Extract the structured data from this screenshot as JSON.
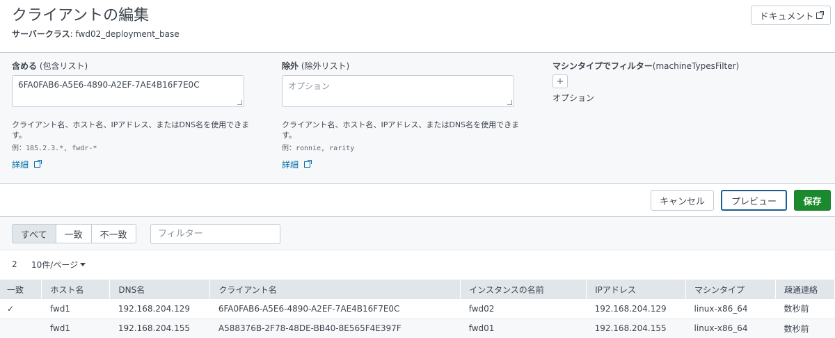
{
  "header": {
    "title": "クライアントの編集",
    "server_class_label": "サーバークラス",
    "server_class_value": ": fwd02_deployment_base",
    "doc_button": "ドキュメント"
  },
  "include": {
    "label_bold": "含める",
    "label_rest": " (包含リスト)",
    "value": "6FA0FAB6-A5E6-4890-A2EF-7AE4B16F7E0C",
    "help": "クライアント名、ホスト名、IPアドレス、またはDNS名を使用できます。",
    "example_lead": "例：",
    "example": "185.2.3.*, fwdr-*",
    "more": "詳細"
  },
  "exclude": {
    "label_bold": "除外",
    "label_rest": " (除外リスト)",
    "placeholder": "オプション",
    "help": "クライアント名、ホスト名、IPアドレス、またはDNS名を使用できます。",
    "example_lead": "例：",
    "example": "ronnie, rarity",
    "more": "詳細"
  },
  "machine_filter": {
    "label_bold": "マシンタイプでフィルター",
    "label_rest": "(machineTypesFilter)",
    "plus": "+",
    "option_label": "オプション"
  },
  "actions": {
    "cancel": "キャンセル",
    "preview": "プレビュー",
    "save": "保存"
  },
  "toolbar": {
    "tabs": [
      "すべて",
      "一致",
      "不一致"
    ],
    "filter_placeholder": "フィルター"
  },
  "summary": {
    "count": "2",
    "per_page": "10件/ページ"
  },
  "table": {
    "columns": [
      "一致",
      "ホスト名",
      "DNS名",
      "クライアント名",
      "インスタンスの名前",
      "IPアドレス",
      "マシンタイプ",
      "疎通連絡"
    ],
    "rows": [
      [
        "✓",
        "fwd1",
        "192.168.204.129",
        "6FA0FAB6-A5E6-4890-A2EF-7AE4B16F7E0C",
        "fwd02",
        "192.168.204.129",
        "linux-x86_64",
        "数秒前"
      ],
      [
        "",
        "fwd1",
        "192.168.204.155",
        "A588376B-2F78-48DE-BB40-8E565F4E397F",
        "fwd01",
        "192.168.204.155",
        "linux-x86_64",
        "数秒前"
      ]
    ]
  },
  "colors": {
    "save_green": "#1a8a2c",
    "preview_border": "#1a5d94",
    "link_blue": "#006eaa",
    "panel_bg": "#f7f8fa"
  }
}
